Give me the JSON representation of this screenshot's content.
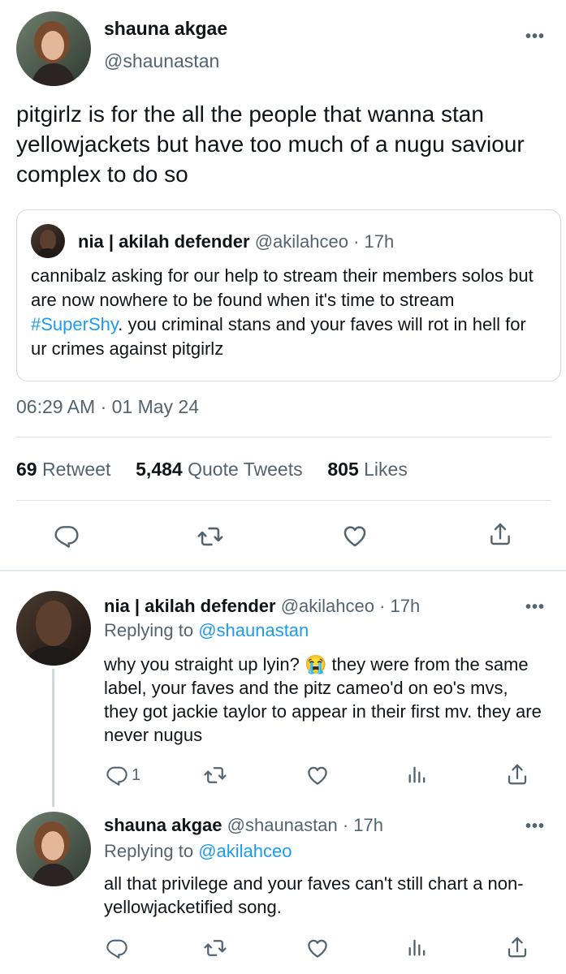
{
  "main_tweet": {
    "author_name": "shauna akgae",
    "author_handle": "@shaunastan",
    "more": "•••",
    "text": "pitgirlz is for the all the people that wanna stan yellowjackets but have too much of a nugu saviour complex to do so",
    "timestamp": "06:29 AM · 01 May 24",
    "quote": {
      "author_name": "nia | akilah defender",
      "author_handle": "@akilahceo",
      "age": "· 17h",
      "text_before": "cannibalz asking for our help to stream their members solos but are now nowhere to be found when it's time to stream ",
      "hashtag": "#SuperShy",
      "text_after": ". you criminal stans and your faves will rot in hell for ur crimes against pitgirlz"
    },
    "stats": {
      "retweets": "69",
      "retweets_label": "Retweet",
      "quotes": "5,484",
      "quotes_label": "Quote Tweets",
      "likes": "805",
      "likes_label": "Likes"
    }
  },
  "replies": [
    {
      "author_name": "nia | akilah defender",
      "author_handle": "@akilahceo",
      "age": "· 17h",
      "more": "•••",
      "replying_label": "Replying to ",
      "replying_to": "@shaunastan",
      "text": "why you straight up lyin? 😭 they were from the same label, your faves and the pitz cameo'd on eo's mvs, they got jackie taylor to appear in their first mv. they are never nugus",
      "reply_count": "1"
    },
    {
      "author_name": "shauna akgae",
      "author_handle": "@shaunastan",
      "age": "· 17h",
      "more": "•••",
      "replying_label": "Replying to ",
      "replying_to": "@akilahceo",
      "text": "all that privilege and your faves can't still chart a non-yellowjacketified song.",
      "reply_count": ""
    }
  ],
  "colors": {
    "accent": "#1d9bf0",
    "muted": "#536471",
    "text": "#0f1419",
    "border": "#cfd9de"
  },
  "icons": [
    "reply-icon",
    "retweet-icon",
    "like-icon",
    "share-icon",
    "analytics-icon",
    "more-icon"
  ]
}
